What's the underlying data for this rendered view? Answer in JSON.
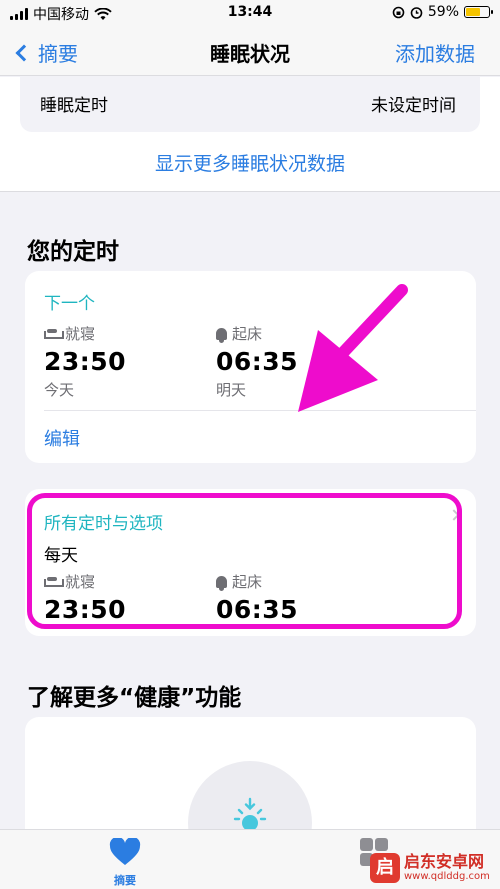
{
  "status_bar": {
    "carrier": "中国移动",
    "time": "13:44",
    "battery": "59%"
  },
  "nav": {
    "back_label": "摘要",
    "title": "睡眠状况",
    "action_label": "添加数据"
  },
  "sleep_duration": {
    "label": "睡眠定时",
    "value": "未设定时间"
  },
  "more_link": "显示更多睡眠状况数据",
  "schedule_section": {
    "title": "您的定时",
    "next": {
      "label": "下一个",
      "bedtime_label": "就寝",
      "bedtime": "23:50",
      "bedtime_day": "今天",
      "wake_label": "起床",
      "wake": "06:35",
      "wake_day": "明天",
      "edit_label": "编辑"
    },
    "all": {
      "label": "所有定时与选项",
      "days": "每天",
      "bedtime_label": "就寝",
      "bedtime": "23:50",
      "wake_label": "起床",
      "wake": "06:35"
    }
  },
  "learn_section": {
    "title": "了解更多“健康”功能"
  },
  "tab_bar": {
    "summary_label": "摘要"
  },
  "watermark": {
    "name": "启东安卓网",
    "url": "www.qdlddg.com"
  },
  "colors": {
    "accent": "#2b7de1",
    "teal": "#1fb5c0",
    "highlight": "#ee0ccc",
    "sun": "#47c7dd",
    "heart": "#2b7de1"
  },
  "icons": [
    "signal-icon",
    "wifi-icon",
    "battery-icon",
    "bed-icon",
    "bell-icon",
    "sun-icon",
    "heart-icon",
    "grid-icon"
  ]
}
